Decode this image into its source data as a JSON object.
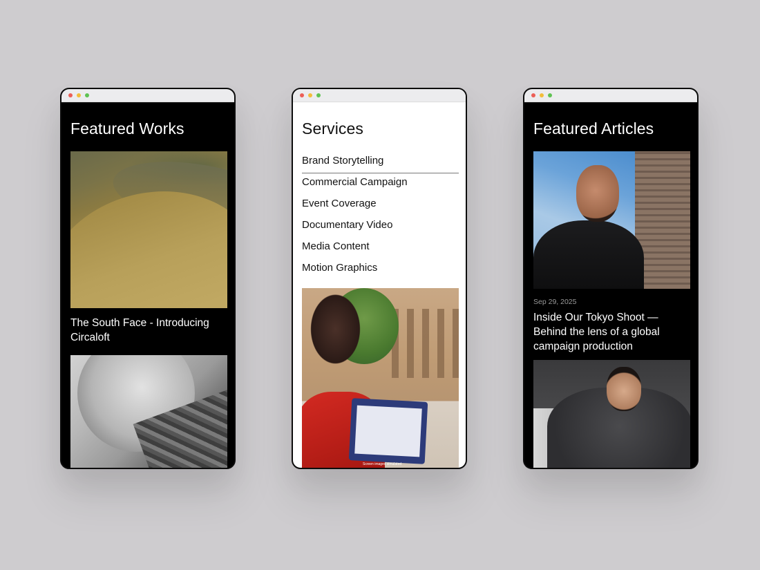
{
  "phones": {
    "works": {
      "title": "Featured Works",
      "items": [
        {
          "caption": "The South Face - Introducing Circaloft"
        }
      ]
    },
    "services": {
      "title": "Services",
      "items": [
        {
          "label": "Brand Storytelling",
          "active": true
        },
        {
          "label": "Commercial Campaign"
        },
        {
          "label": "Event Coverage"
        },
        {
          "label": "Documentary Video"
        },
        {
          "label": "Media Content"
        },
        {
          "label": "Motion Graphics"
        }
      ],
      "image_caption": "Screen images simulated"
    },
    "articles": {
      "title": "Featured Articles",
      "items": [
        {
          "date": "Sep 29, 2025",
          "title": "Inside Our Tokyo Shoot — Behind the lens of a global campaign production"
        }
      ]
    }
  },
  "colors": {
    "background": "#cecccf",
    "dark_surface": "#000000",
    "light_surface": "#ffffff",
    "traffic_red": "#ec5f57",
    "traffic_yellow": "#f2bd3a",
    "traffic_green": "#5fc253"
  }
}
